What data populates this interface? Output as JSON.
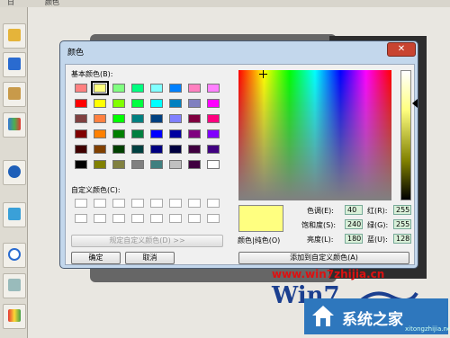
{
  "top_menu": [
    "日",
    "颜色"
  ],
  "dialog": {
    "title": "颜色",
    "close_symbol": "✕",
    "basic_colors_label": "基本颜色(B):",
    "basic_colors": [
      [
        "#ff8080",
        "#ffff80",
        "#80ff80",
        "#00ff80",
        "#80ffff",
        "#0080ff",
        "#ff80c0",
        "#ff80ff"
      ],
      [
        "#ff0000",
        "#ffff00",
        "#80ff00",
        "#00ff40",
        "#00ffff",
        "#0080c0",
        "#8080c0",
        "#ff00ff"
      ],
      [
        "#804040",
        "#ff8040",
        "#00ff00",
        "#008080",
        "#004080",
        "#8080ff",
        "#800040",
        "#ff0080"
      ],
      [
        "#800000",
        "#ff8000",
        "#008000",
        "#008040",
        "#0000ff",
        "#0000a0",
        "#800080",
        "#8000ff"
      ],
      [
        "#400000",
        "#804000",
        "#004000",
        "#004040",
        "#000080",
        "#000040",
        "#400040",
        "#400080"
      ],
      [
        "#000000",
        "#808000",
        "#808040",
        "#808080",
        "#408080",
        "#c0c0c0",
        "#400040",
        "#ffffff"
      ]
    ],
    "selected_color": "#ffff80",
    "custom_colors_label": "自定义颜色(C):",
    "define_custom_button": "规定自定义颜色(D) >>",
    "ok_button": "确定",
    "cancel_button": "取消",
    "color_solid_label": "颜色|纯色(O)",
    "add_custom_button": "添加到自定义颜色(A)",
    "hue_label": "色调(E):",
    "hue_value": "40",
    "sat_label": "饱和度(S):",
    "sat_value": "240",
    "lum_label": "亮度(L):",
    "lum_value": "180",
    "red_label": "红(R):",
    "red_value": "255",
    "green_label": "绿(G):",
    "green_value": "255",
    "blue_label": "蓝(U):",
    "blue_value": "128"
  },
  "watermark": {
    "url": "www.win7zhijia.cn",
    "brand_text": "Win7",
    "corner_brand": "系统之家",
    "corner_url": "xitongzhijia.net"
  }
}
